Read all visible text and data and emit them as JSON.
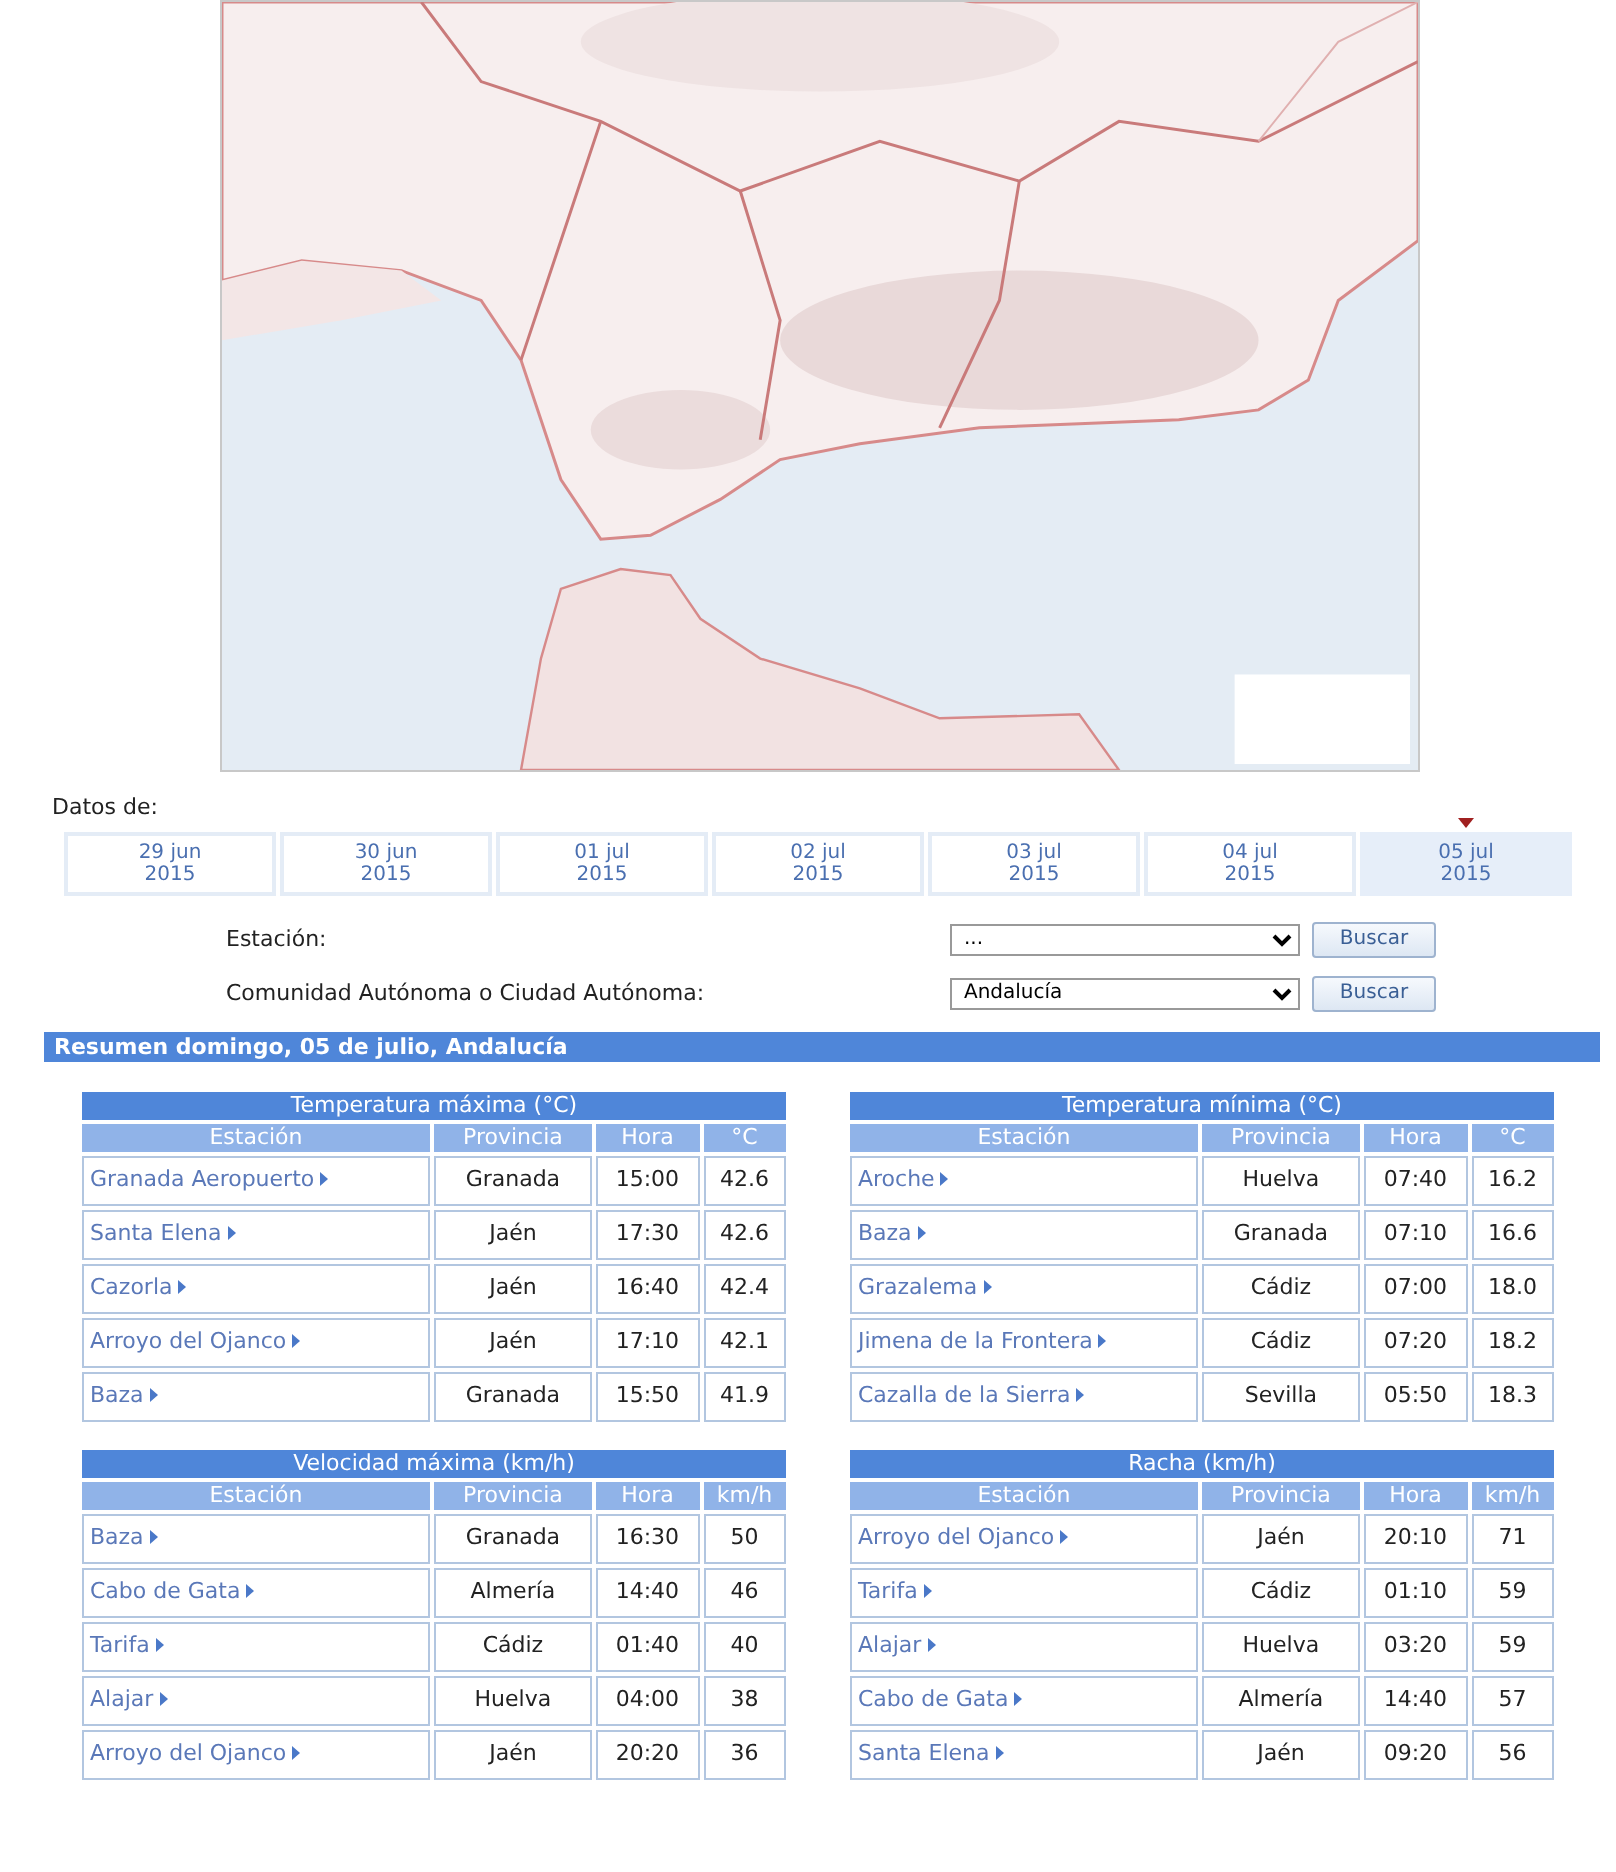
{
  "data_label": "Datos de:",
  "dates": [
    {
      "day": "29 jun",
      "year": "2015",
      "selected": false
    },
    {
      "day": "30 jun",
      "year": "2015",
      "selected": false
    },
    {
      "day": "01 jul",
      "year": "2015",
      "selected": false
    },
    {
      "day": "02 jul",
      "year": "2015",
      "selected": false
    },
    {
      "day": "03 jul",
      "year": "2015",
      "selected": false
    },
    {
      "day": "04 jul",
      "year": "2015",
      "selected": false
    },
    {
      "day": "05 jul",
      "year": "2015",
      "selected": true
    }
  ],
  "filters": [
    {
      "label": "Estación:",
      "value": "...",
      "button": "Buscar"
    },
    {
      "label": "Comunidad Autónoma o Ciudad Autónoma:",
      "value": "Andalucía",
      "button": "Buscar"
    }
  ],
  "summary_title": "Resumen domingo, 05 de julio, Andalucía",
  "tables": [
    {
      "title": "Temperatura máxima (°C)",
      "columns": [
        "Estación",
        "Provincia",
        "Hora",
        "°C"
      ],
      "rows": [
        [
          "Granada Aeropuerto",
          "Granada",
          "15:00",
          "42.6"
        ],
        [
          "Santa Elena",
          "Jaén",
          "17:30",
          "42.6"
        ],
        [
          "Cazorla",
          "Jaén",
          "16:40",
          "42.4"
        ],
        [
          "Arroyo del Ojanco",
          "Jaén",
          "17:10",
          "42.1"
        ],
        [
          "Baza",
          "Granada",
          "15:50",
          "41.9"
        ]
      ]
    },
    {
      "title": "Temperatura mínima (°C)",
      "columns": [
        "Estación",
        "Provincia",
        "Hora",
        "°C"
      ],
      "rows": [
        [
          "Aroche",
          "Huelva",
          "07:40",
          "16.2"
        ],
        [
          "Baza",
          "Granada",
          "07:10",
          "16.6"
        ],
        [
          "Grazalema",
          "Cádiz",
          "07:00",
          "18.0"
        ],
        [
          "Jimena de la Frontera",
          "Cádiz",
          "07:20",
          "18.2"
        ],
        [
          "Cazalla de la Sierra",
          "Sevilla",
          "05:50",
          "18.3"
        ]
      ]
    },
    {
      "title": "Velocidad máxima (km/h)",
      "columns": [
        "Estación",
        "Provincia",
        "Hora",
        "km/h"
      ],
      "rows": [
        [
          "Baza",
          "Granada",
          "16:30",
          "50"
        ],
        [
          "Cabo de Gata",
          "Almería",
          "14:40",
          "46"
        ],
        [
          "Tarifa",
          "Cádiz",
          "01:40",
          "40"
        ],
        [
          "Alajar",
          "Huelva",
          "04:00",
          "38"
        ],
        [
          "Arroyo del Ojanco",
          "Jaén",
          "20:20",
          "36"
        ]
      ]
    },
    {
      "title": "Racha (km/h)",
      "columns": [
        "Estación",
        "Provincia",
        "Hora",
        "km/h"
      ],
      "rows": [
        [
          "Arroyo del Ojanco",
          "Jaén",
          "20:10",
          "71"
        ],
        [
          "Tarifa",
          "Cádiz",
          "01:10",
          "59"
        ],
        [
          "Alajar",
          "Huelva",
          "03:20",
          "59"
        ],
        [
          "Cabo de Gata",
          "Almería",
          "14:40",
          "57"
        ],
        [
          "Santa Elena",
          "Jaén",
          "09:20",
          "56"
        ]
      ]
    }
  ]
}
